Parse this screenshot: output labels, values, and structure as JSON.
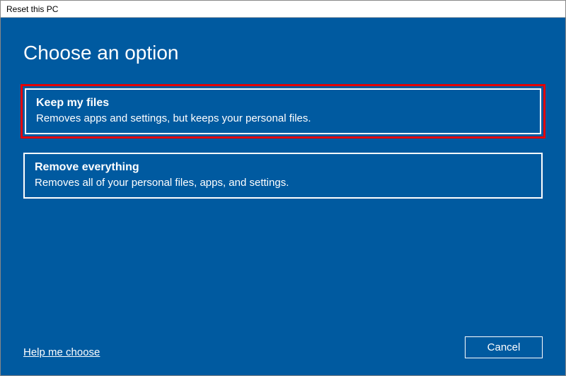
{
  "window": {
    "title": "Reset this PC"
  },
  "heading": "Choose an option",
  "options": [
    {
      "title": "Keep my files",
      "description": "Removes apps and settings, but keeps your personal files.",
      "highlighted": true
    },
    {
      "title": "Remove everything",
      "description": "Removes all of your personal files, apps, and settings.",
      "highlighted": false
    }
  ],
  "footer": {
    "help_link": "Help me choose",
    "cancel_label": "Cancel"
  }
}
